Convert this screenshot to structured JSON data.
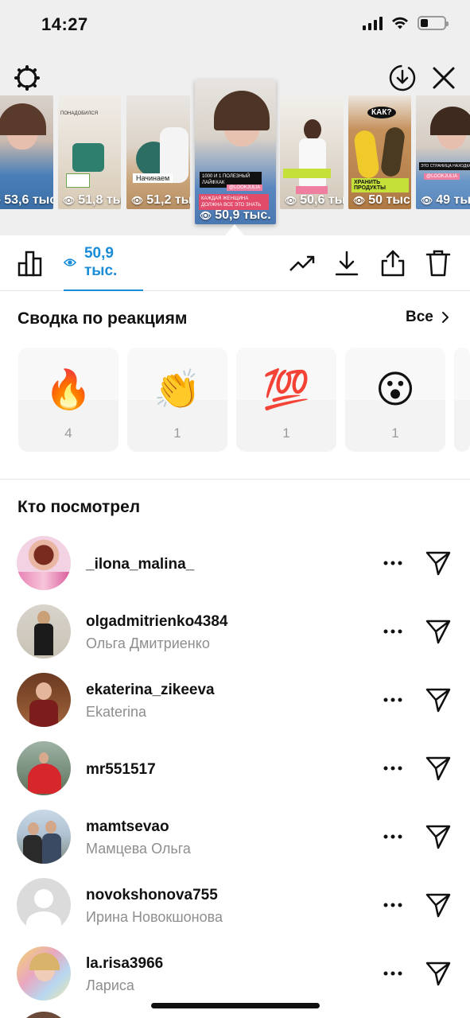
{
  "status_bar": {
    "time": "14:27"
  },
  "stories": [
    {
      "views": "53,6 тыс"
    },
    {
      "views": "51,8 тыс"
    },
    {
      "views": "51,2 тыс"
    },
    {
      "views": "50,9 тыс.",
      "selected": true
    },
    {
      "views": "50,6 тыс"
    },
    {
      "views": "50 тыс"
    },
    {
      "views": "49 тыс"
    }
  ],
  "story_overlay_text": {
    "s2_top": "ПОНАДОБИЛСЯ",
    "s3_caption": "Начинаем",
    "s4_line1": "1000 И 1 ПОЛЕЗНЫЙ",
    "s4_line2": "ЛАЙФХАК",
    "s4_handle": "@LOOKJULIA",
    "s4_red": "КАЖДАЯ ЖЕНЩИНА ДОЛЖНА ВСЕ ЭТО ЗНАТЬ",
    "s6_question": "КАК?",
    "s6_caption": "ХРАНИТЬ ПРОДУКТЫ",
    "s7_top": "ЭТО СТРАНИЦА НАХОДКА",
    "s7_handle": "@LOOKJULIA"
  },
  "toolbar": {
    "views_count": "50,9 тыс."
  },
  "reactions": {
    "title": "Сводка по реакциям",
    "all_label": "Все",
    "items": [
      {
        "emoji": "🔥",
        "count": "4"
      },
      {
        "emoji": "👏",
        "count": "1"
      },
      {
        "emoji": "💯",
        "count": "1"
      },
      {
        "emoji": "😮",
        "count": "1"
      }
    ]
  },
  "viewers": {
    "title": "Кто посмотрел",
    "items": [
      {
        "username": "_ilona_malina_",
        "fullname": ""
      },
      {
        "username": "olgadmitrienko4384",
        "fullname": "Ольга Дмитриенко"
      },
      {
        "username": "ekaterina_zikeeva",
        "fullname": "Ekaterina"
      },
      {
        "username": "mr551517",
        "fullname": ""
      },
      {
        "username": "mamtsevao",
        "fullname": "Мамцева Ольга"
      },
      {
        "username": "novokshonova755",
        "fullname": "Ирина Новокшонова"
      },
      {
        "username": "la.risa3966",
        "fullname": "Лариса"
      }
    ]
  },
  "colors": {
    "accent": "#1a8cd8",
    "muted": "#8e8e8e"
  }
}
